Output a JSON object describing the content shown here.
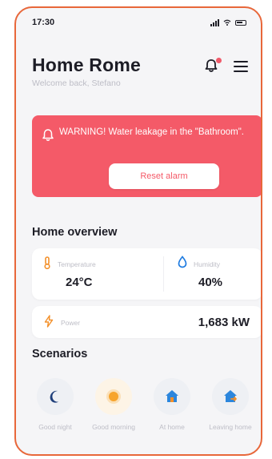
{
  "status_bar": {
    "time": "17:30"
  },
  "header": {
    "title": "Home Rome",
    "subtitle": "Welcome back, Stefano"
  },
  "alert": {
    "message": "WARNING! Water leakage in the \"Bathroom\".",
    "button_label": "Reset alarm"
  },
  "overview": {
    "title": "Home overview",
    "temperature": {
      "label": "Temperature",
      "value": "24°C"
    },
    "humidity": {
      "label": "Humidity",
      "value": "40%"
    },
    "power": {
      "label": "Power",
      "value": "1,683 kW"
    }
  },
  "scenarios": {
    "title": "Scenarios",
    "items": [
      {
        "label": "Good night",
        "icon": "moon-icon"
      },
      {
        "label": "Good morning",
        "icon": "sun-icon"
      },
      {
        "label": "At home",
        "icon": "home-icon"
      },
      {
        "label": "Leaving home",
        "icon": "leaving-home-icon"
      }
    ]
  },
  "colors": {
    "accent_orange": "#f3902a",
    "alert_red": "#f45a68",
    "humidity_blue": "#1e7be0",
    "scenario_blue": "#2c86dc",
    "night_blue": "#1f3f7a"
  }
}
